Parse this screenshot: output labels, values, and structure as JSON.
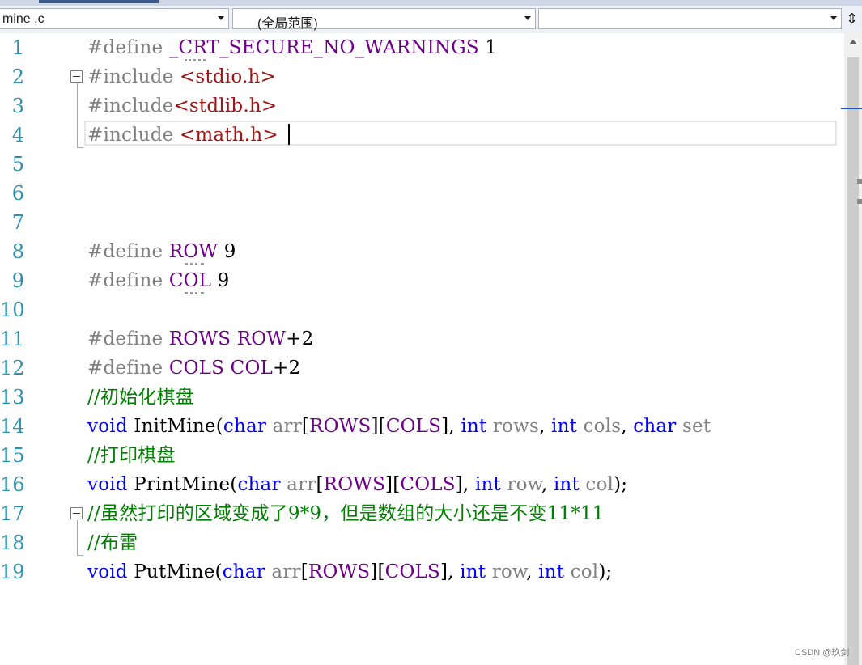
{
  "navbar": {
    "file_combo": "mine .c",
    "scope_combo": "(全局范围)",
    "member_combo": ""
  },
  "colors": {
    "keyword": "#0000ff",
    "macro": "#6f008a",
    "string": "#a31515",
    "comment": "#008000",
    "line_number": "#2b91af"
  },
  "editor": {
    "line_numbers": [
      "1",
      "2",
      "3",
      "4",
      "5",
      "6",
      "7",
      "8",
      "9",
      "10",
      "11",
      "12",
      "13",
      "14",
      "15",
      "16",
      "17",
      "18",
      "19"
    ],
    "lines": {
      "l1": [
        "#define",
        " ",
        "_CRT_SECURE_NO_WARNINGS",
        " 1"
      ],
      "l2": [
        "#include",
        " ",
        "<stdio.h>"
      ],
      "l3": [
        "#include",
        "<stdlib.h>"
      ],
      "l4": [
        "#include",
        " ",
        "<math.h>"
      ],
      "l8": [
        "#define",
        " ",
        "ROW",
        " 9"
      ],
      "l9": [
        "#define",
        " ",
        "COL",
        " 9"
      ],
      "l11": [
        "#define",
        " ",
        "ROWS",
        " ",
        "ROW",
        "+2"
      ],
      "l12": [
        "#define",
        " ",
        "COLS",
        " ",
        "COL",
        "+2"
      ],
      "l13": "//初始化棋盘",
      "l14": [
        "void",
        " ",
        "InitMine",
        "(",
        "char",
        " ",
        "arr",
        "[",
        "ROWS",
        "][",
        "COLS",
        "], ",
        "int",
        " ",
        "rows",
        ", ",
        "int",
        " ",
        "cols",
        ", ",
        "char",
        " ",
        "set"
      ],
      "l15": "//打印棋盘",
      "l16": [
        "void",
        " ",
        "PrintMine",
        "(",
        "char",
        " ",
        "arr",
        "[",
        "ROWS",
        "][",
        "COLS",
        "], ",
        "int",
        " ",
        "row",
        ", ",
        "int",
        " ",
        "col",
        ");"
      ],
      "l17": "//虽然打印的区域变成了9*9，但是数组的大小还是不变11*11",
      "l18": "//布雷",
      "l19": [
        "void",
        " ",
        "PutMine",
        "(",
        "char",
        " ",
        "arr",
        "[",
        "ROWS",
        "][",
        "COLS",
        "], ",
        "int",
        " ",
        "row",
        ", ",
        "int",
        " ",
        "col",
        ");"
      ]
    }
  },
  "watermark": "CSDN @玖剑"
}
